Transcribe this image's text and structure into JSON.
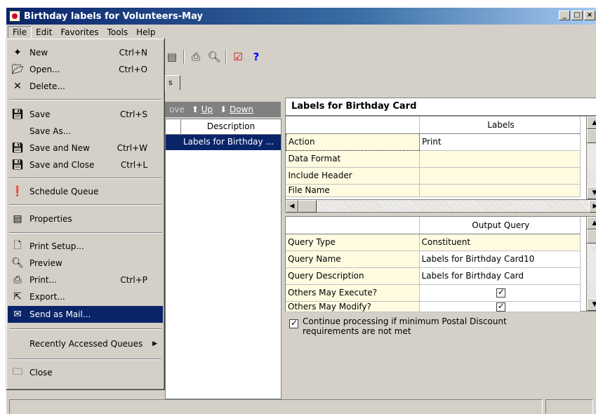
{
  "window": {
    "title": "Birthday labels for Volunteers-May",
    "min": "_",
    "max": "□",
    "close": "×"
  },
  "menubar": [
    "File",
    "Edit",
    "Favorites",
    "Tools",
    "Help"
  ],
  "file_menu": {
    "items": [
      {
        "label": "New",
        "shortcut": "Ctrl+N",
        "icon": "new-icon"
      },
      {
        "label": "Open...",
        "shortcut": "Ctrl+O",
        "icon": "open-icon"
      },
      {
        "label": "Delete...",
        "shortcut": "",
        "icon": "delete-icon"
      },
      {
        "label": "Save",
        "shortcut": "Ctrl+S",
        "icon": "save-icon"
      },
      {
        "label": "Save As...",
        "shortcut": "",
        "icon": ""
      },
      {
        "label": "Save and New",
        "shortcut": "Ctrl+W",
        "icon": "save-new-icon"
      },
      {
        "label": "Save and Close",
        "shortcut": "Ctrl+L",
        "icon": "save-close-icon"
      },
      {
        "label": "Schedule Queue",
        "shortcut": "",
        "icon": "schedule-icon"
      },
      {
        "label": "Properties",
        "shortcut": "",
        "icon": "properties-icon"
      },
      {
        "label": "Print Setup...",
        "shortcut": "",
        "icon": "print-setup-icon"
      },
      {
        "label": "Preview",
        "shortcut": "",
        "icon": "preview-icon"
      },
      {
        "label": "Print...",
        "shortcut": "Ctrl+P",
        "icon": "print-icon"
      },
      {
        "label": "Export...",
        "shortcut": "",
        "icon": "export-icon"
      },
      {
        "label": "Send as Mail...",
        "shortcut": "",
        "icon": "mail-icon"
      },
      {
        "label": "Recently Accessed Queues",
        "shortcut": "",
        "icon": ""
      },
      {
        "label": "Close",
        "shortcut": "",
        "icon": "close-doc-icon"
      }
    ],
    "highlighted": "Send as Mail..."
  },
  "toolbar": {
    "help": "?"
  },
  "tab": {
    "fragment": "s"
  },
  "list_toolbar": {
    "move_fragment": "ove",
    "up": "Up",
    "down": "Down"
  },
  "list": {
    "column": "Description",
    "rows": [
      "Labels for Birthday ..."
    ]
  },
  "right": {
    "title": "Labels for Birthday Card",
    "labels_grid": {
      "header": "Labels",
      "rows": [
        {
          "k": "Action",
          "v": "Print"
        },
        {
          "k": "Data Format",
          "v": ""
        },
        {
          "k": "Include Header",
          "v": ""
        },
        {
          "k": "File Name",
          "v": ""
        }
      ]
    },
    "output_grid": {
      "header": "Output Query",
      "rows": [
        {
          "k": "Query Type",
          "v": "Constituent"
        },
        {
          "k": "Query Name",
          "v": "Labels for Birthday Card10"
        },
        {
          "k": "Query Description",
          "v": "Labels for Birthday Card"
        },
        {
          "k": "Others May Execute?",
          "v": "checked"
        },
        {
          "k": "Others May Modify?",
          "v": "checked"
        }
      ]
    },
    "option": {
      "label": "Continue processing if minimum Postal Discount requirements are not met",
      "checked": true
    }
  }
}
